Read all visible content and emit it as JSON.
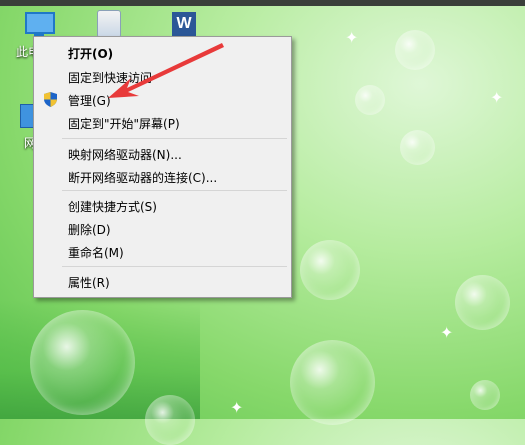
{
  "desktop": {
    "icons": [
      {
        "label": "此电脑",
        "icon": "this-pc-icon"
      },
      {
        "label": "",
        "icon": "recycle-bin-icon"
      },
      {
        "label": "",
        "icon": "word-document-icon"
      },
      {
        "label": "网",
        "icon": "network-icon"
      }
    ]
  },
  "context_menu": {
    "items": [
      {
        "label": "打开(O)",
        "bold": true
      },
      {
        "label": "固定到快速访问"
      },
      {
        "label": "管理(G)",
        "icon": "uac-shield-icon"
      },
      {
        "label": "固定到\"开始\"屏幕(P)"
      },
      {
        "label": "映射网络驱动器(N)..."
      },
      {
        "label": "断开网络驱动器的连接(C)..."
      },
      {
        "label": "创建快捷方式(S)"
      },
      {
        "label": "删除(D)"
      },
      {
        "label": "重命名(M)"
      },
      {
        "label": "属性(R)"
      }
    ]
  },
  "annotation": {
    "color": "#e83a3a",
    "icon": "red-arrow-annotation"
  }
}
